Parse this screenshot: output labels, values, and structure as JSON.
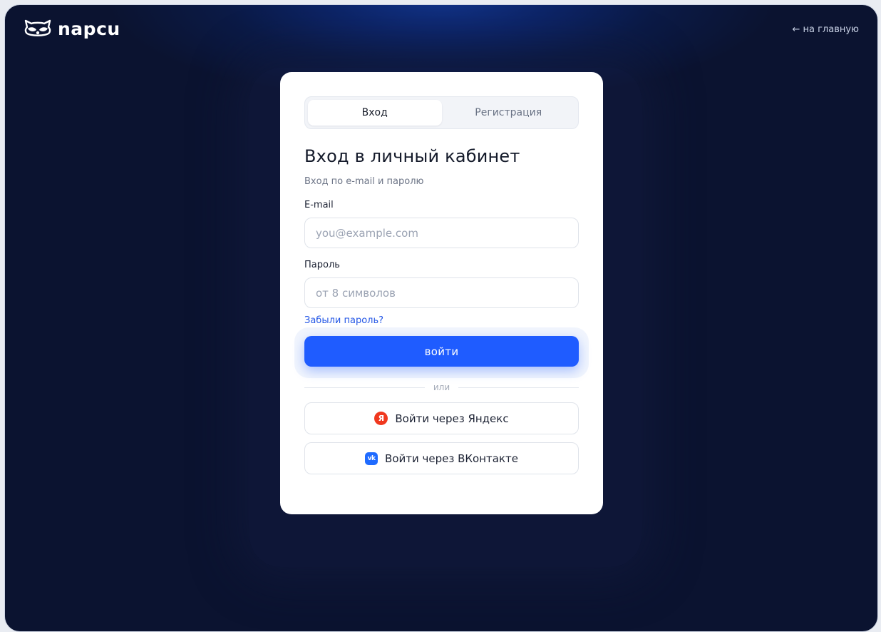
{
  "brand": {
    "name": "napcu"
  },
  "nav": {
    "home_link": "← на главную"
  },
  "tabs": [
    {
      "label": "Вход",
      "active": true
    },
    {
      "label": "Регистрация",
      "active": false
    }
  ],
  "form": {
    "title": "Вход в личный кабинет",
    "subtitle": "Вход по e-mail и паролю",
    "email": {
      "label": "E-mail",
      "placeholder": "you@example.com",
      "value": ""
    },
    "password": {
      "label": "Пароль",
      "placeholder": "от 8 символов",
      "value": ""
    },
    "forgot_label": "Забыли пароль?",
    "submit_label": "войти",
    "divider_label": "или"
  },
  "social": {
    "yandex": {
      "label": "Войти через Яндекс",
      "icon": "yandex-icon",
      "icon_glyph": "Я"
    },
    "vk": {
      "label": "Войти через ВКонтакте",
      "icon": "vk-icon",
      "icon_glyph": "vk"
    }
  },
  "colors": {
    "accent": "#1f5cff",
    "link": "#2457e6",
    "background": "#0b1330",
    "yandex": "#f0381e",
    "vk": "#1f6bff"
  }
}
